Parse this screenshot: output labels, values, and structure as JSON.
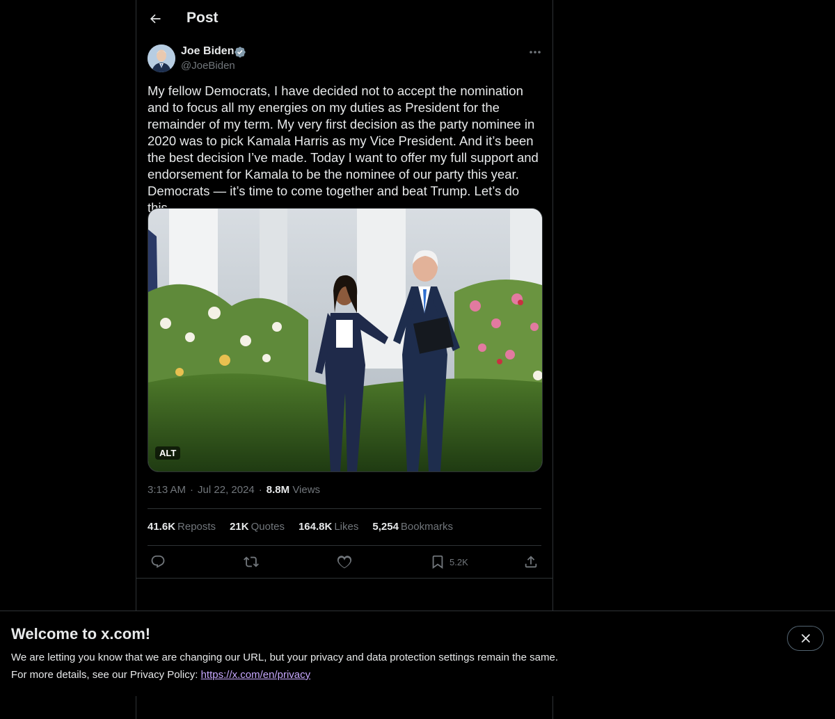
{
  "header": {
    "title": "Post",
    "back_icon": "arrow-left-icon"
  },
  "author": {
    "name": "Joe Biden",
    "handle": "@JoeBiden",
    "verified_icon": "verified-badge-icon"
  },
  "tweet": {
    "text": "My fellow Democrats, I have decided not to accept the nomination and to focus all my energies on my duties as President for the remainder of my term. My very first decision as the party nominee in 2020 was to pick Kamala Harris as my Vice President. And it’s been the best decision I’ve made. Today I want to offer my full support and endorsement for Kamala to be the nominee of our party this year. Democrats — it’s time to come together and beat Trump. Let’s do this.",
    "alt_badge": "ALT"
  },
  "meta": {
    "time": "3:13 AM",
    "date": "Jul 22, 2024",
    "views_count": "8.8M",
    "views_label": "Views"
  },
  "stats": {
    "reposts_count": "41.6K",
    "reposts_label": "Reposts",
    "quotes_count": "21K",
    "quotes_label": "Quotes",
    "likes_count": "164.8K",
    "likes_label": "Likes",
    "bookmarks_count": "5,254",
    "bookmarks_label": "Bookmarks"
  },
  "actions": {
    "bookmark_count": "5.2K"
  },
  "banner": {
    "title": "Welcome to x.com!",
    "line1": "We are letting you know that we are changing our URL, but your privacy and data protection settings remain the same.",
    "line2_prefix": "For more details, see our Privacy Policy: ",
    "link": "https://x.com/en/privacy"
  },
  "colors": {
    "background": "#000000",
    "text": "#e7e9ea",
    "muted": "#71767b",
    "border": "#2f3336",
    "verified": "#829aab",
    "link": "#c7a8ff"
  }
}
